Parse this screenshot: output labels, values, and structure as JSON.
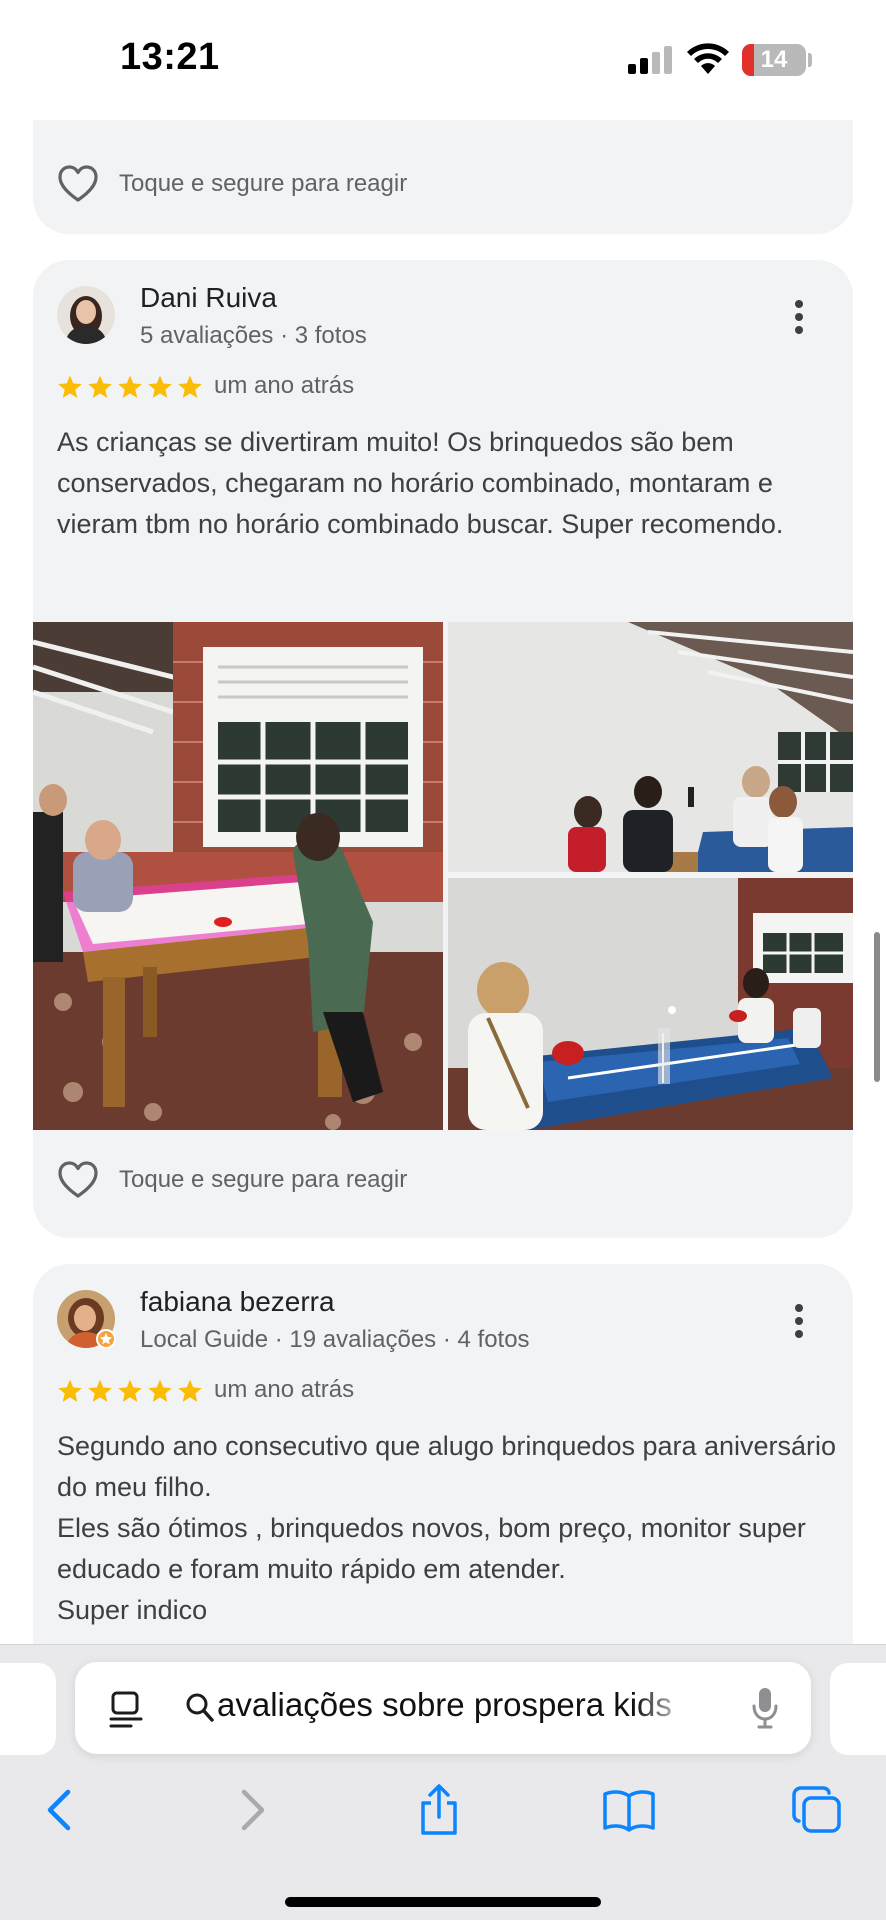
{
  "status_bar": {
    "time": "13:21",
    "battery_level": "14",
    "battery_color": "#e0322b"
  },
  "reaction_label": "Toque e segure para reagir",
  "reviews": [
    {
      "name": "Dani Ruiva",
      "meta": "5 avaliações · 3 fotos",
      "stars": 5,
      "date": "um ano atrás",
      "text": "As crianças se divertiram muito! Os brinquedos são bem conservados, chegaram no horário combinado, montaram e vieram tbm no horário combinado buscar. Super recomendo.",
      "photos": [
        "air-hockey-table-photo",
        "kids-playing-photo",
        "ping-pong-table-photo"
      ]
    },
    {
      "name": "fabiana bezerra",
      "meta": "Local Guide · 19 avaliações · 4 fotos",
      "stars": 5,
      "date": "um ano atrás",
      "text": "Segundo ano consecutivo que alugo brinquedos para aniversário do meu filho.\nEles são ótimos , brinquedos novos, bom preço, monitor super educado e foram muito rápido em atender.\nSuper indico"
    }
  ],
  "browser": {
    "address_text": "avaliações sobre prospera kids",
    "icons": [
      "page-menu-icon",
      "search-icon",
      "microphone-icon",
      "back-icon",
      "forward-icon",
      "share-icon",
      "bookmarks-icon",
      "tabs-icon"
    ]
  },
  "colors": {
    "star": "#fbbc04",
    "card_bg": "#f1f3f4",
    "toolbar_blue": "#0a84ff"
  }
}
